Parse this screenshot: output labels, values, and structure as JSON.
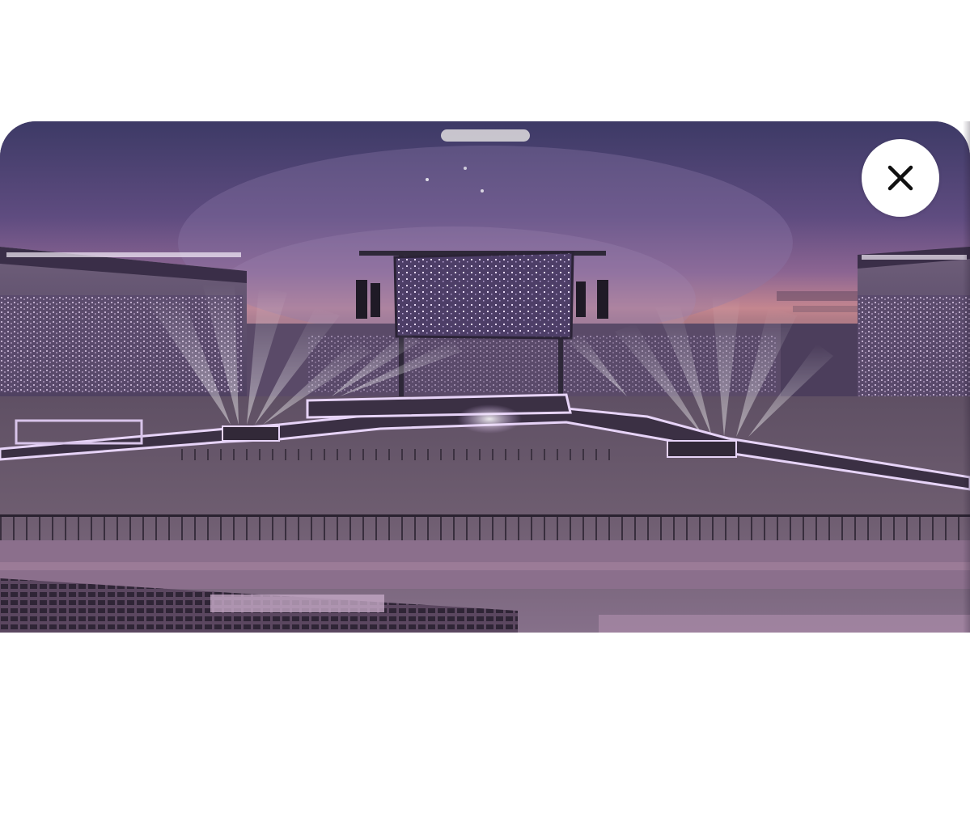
{
  "modal": {
    "image": {
      "description_icon": "stadium-stage-render",
      "sky_top_color": "#3e3a66",
      "sky_mid_color": "#7a5a8e",
      "sky_horizon_color": "#c98a8e",
      "stage_glow_color": "#c8a6e6",
      "floor_color": "#6b5a6e"
    },
    "drag_handle": {
      "icon": "drag-handle-icon",
      "color": "#d4d0d6"
    },
    "close_button": {
      "icon": "close-icon",
      "background": "#ffffff",
      "glyph_color": "#111111"
    }
  }
}
